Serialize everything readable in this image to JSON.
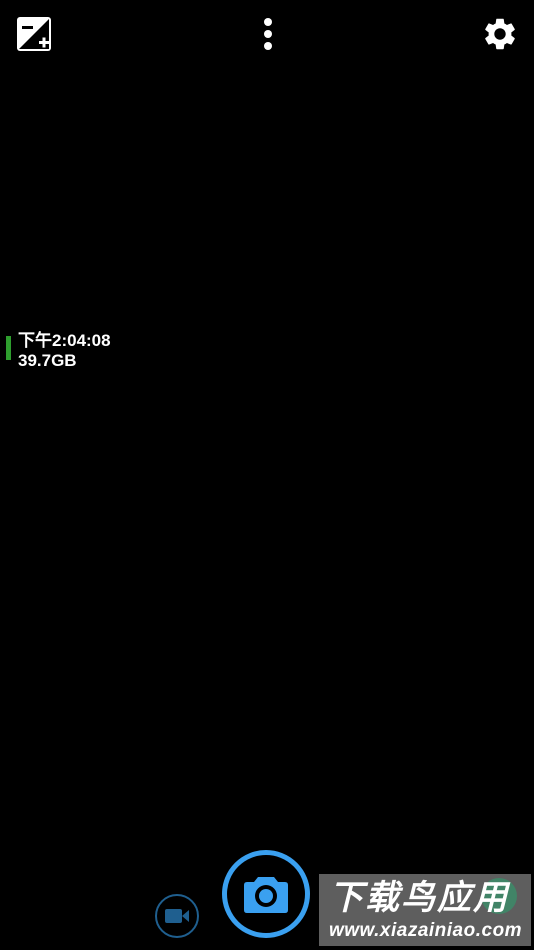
{
  "topbar": {
    "exposure_icon": "exposure-plus-icon",
    "menu_icon": "more-vertical-icon",
    "settings_icon": "gear-icon"
  },
  "info": {
    "time": "下午2:04:08",
    "storage": "39.7GB",
    "battery_color": "#2e9e2e"
  },
  "controls": {
    "video_icon": "video-camera-icon",
    "shutter_icon": "camera-icon",
    "accent_color": "#3aa0f0"
  },
  "watermark": {
    "title": "下载鸟应用",
    "url": "www.xiazainiao.com"
  }
}
